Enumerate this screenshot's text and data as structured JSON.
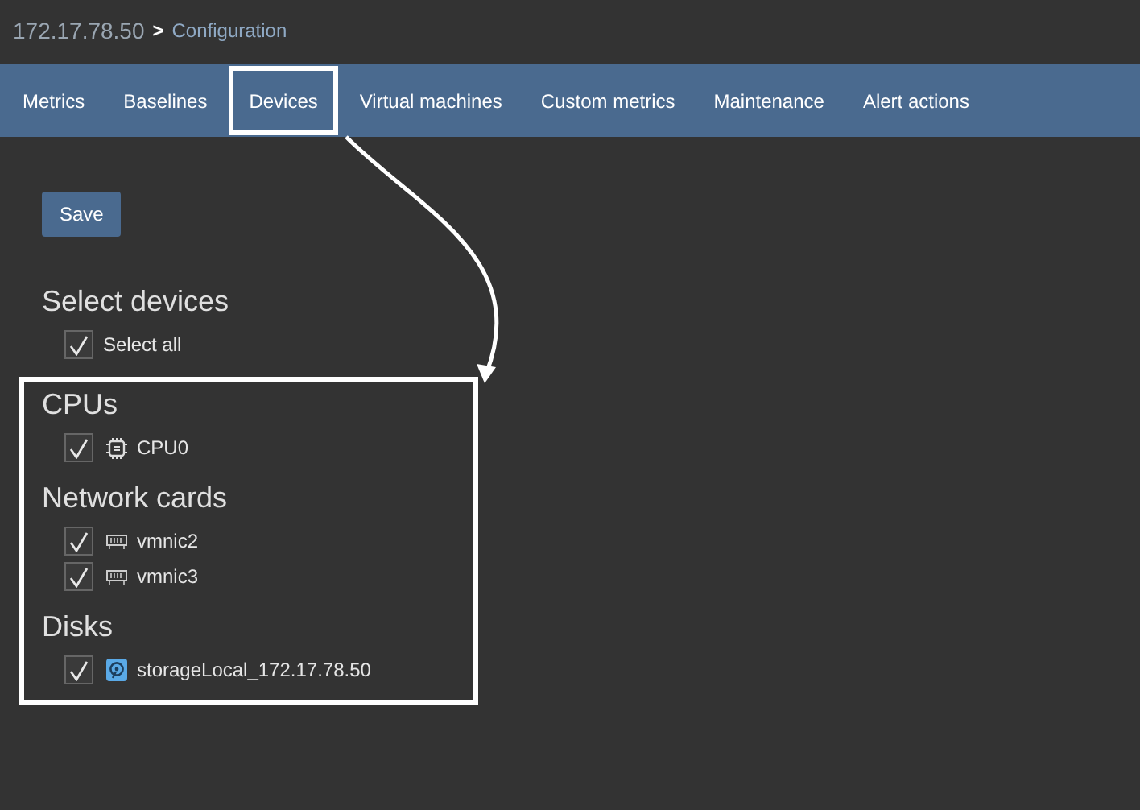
{
  "breadcrumb": {
    "host": "172.17.78.50",
    "separator": ">",
    "page": "Configuration"
  },
  "tabs": [
    {
      "label": "Metrics",
      "selected": false
    },
    {
      "label": "Baselines",
      "selected": false
    },
    {
      "label": "Devices",
      "selected": true
    },
    {
      "label": "Virtual machines",
      "selected": false
    },
    {
      "label": "Custom metrics",
      "selected": false
    },
    {
      "label": "Maintenance",
      "selected": false
    },
    {
      "label": "Alert actions",
      "selected": false
    }
  ],
  "save_button": "Save",
  "select_devices": {
    "title": "Select devices",
    "select_all": {
      "label": "Select all",
      "checked": true
    }
  },
  "groups": [
    {
      "title": "CPUs",
      "items": [
        {
          "label": "CPU0",
          "kind": "cpu",
          "checked": true
        }
      ]
    },
    {
      "title": "Network cards",
      "items": [
        {
          "label": "vmnic2",
          "kind": "network",
          "checked": true
        },
        {
          "label": "vmnic3",
          "kind": "network",
          "checked": true
        }
      ]
    },
    {
      "title": "Disks",
      "items": [
        {
          "label": "storageLocal_172.17.78.50",
          "kind": "disk",
          "checked": true
        }
      ]
    }
  ]
}
